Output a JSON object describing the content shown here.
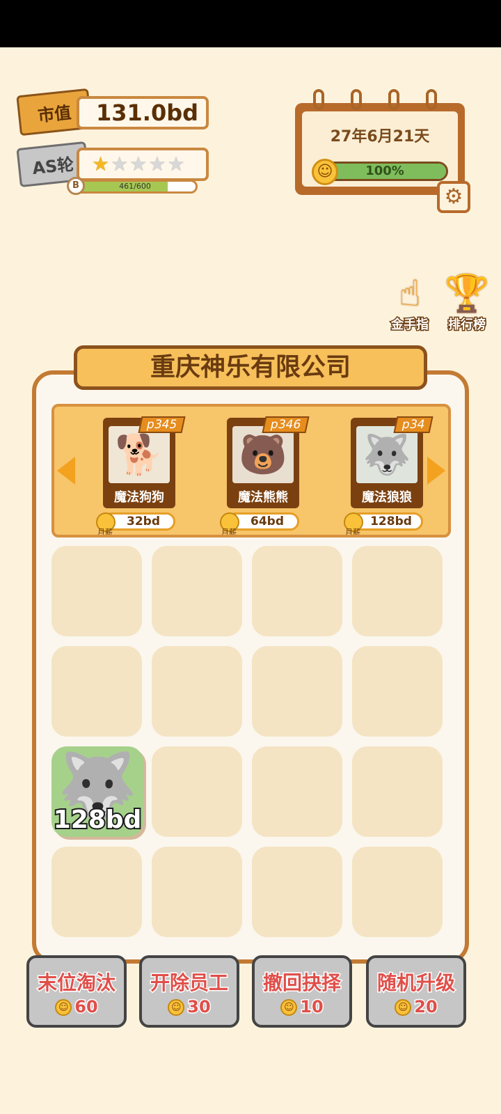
{
  "market_value": {
    "tag": "市值",
    "value": "131.0bd"
  },
  "round": {
    "tag": "AS轮",
    "stars_on": 1,
    "stars_total": 5,
    "exp_text": "461/600",
    "exp_fraction": 0.768,
    "exp_icon": "B"
  },
  "calendar": {
    "date": "27年6月21天",
    "mood_text": "100%",
    "mood_fraction": 1.0
  },
  "side": {
    "gold_finger": "金手指",
    "ranking": "排行榜"
  },
  "company": {
    "name": "重庆神乐有限公司"
  },
  "shop": {
    "cards": [
      {
        "tag": "p345",
        "name": "魔法狗狗",
        "price": "32bd",
        "coin_label": "月薪",
        "portrait_icon": "dog-icon",
        "portrait_bg": "#efe6d6"
      },
      {
        "tag": "p346",
        "name": "魔法熊熊",
        "price": "64bd",
        "coin_label": "月薪",
        "portrait_icon": "bear-icon",
        "portrait_bg": "#e9dfd0"
      },
      {
        "tag": "p34",
        "name": "魔法狼狼",
        "price": "128bd",
        "coin_label": "月薪",
        "portrait_icon": "wolf-icon",
        "portrait_bg": "#dfe5dc"
      }
    ]
  },
  "staff": {
    "value": "128bd",
    "icon": "wolf-icon"
  },
  "actions": [
    {
      "label": "末位淘汰",
      "cost": "60"
    },
    {
      "label": "开除员工",
      "cost": "30"
    },
    {
      "label": "撤回抉择",
      "cost": "10"
    },
    {
      "label": "随机升级",
      "cost": "20"
    }
  ],
  "colors": {
    "accent": "#c37a33",
    "background": "#fdf3dd",
    "action_text": "#e04f4a"
  }
}
